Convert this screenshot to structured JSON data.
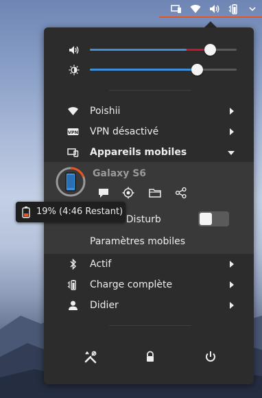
{
  "topbar": {
    "icons": [
      "phone-device-icon",
      "wifi-icon",
      "volume-icon",
      "battery-icon"
    ],
    "accent": "#e95420"
  },
  "sliders": {
    "volume": {
      "icon": "volume-icon",
      "level": 0.82
    },
    "brightness": {
      "icon": "brightness-icon",
      "level": 0.73
    }
  },
  "menu": {
    "wifi": {
      "label": "Poishii"
    },
    "vpn": {
      "label": "VPN désactivé"
    },
    "mobile": {
      "label": "Appareils mobiles"
    },
    "bluetooth": {
      "label": "Actif"
    },
    "battery": {
      "label": "Charge complète"
    },
    "user": {
      "label": "Didier"
    }
  },
  "device": {
    "name": "Galaxy S6",
    "battery_percent": 19,
    "dnd_label": "Do Not Disturb",
    "dnd_enabled": false,
    "settings_label": "Paramètres mobiles",
    "actions": [
      "message-icon",
      "locate-icon",
      "folder-icon",
      "share-icon"
    ]
  },
  "tooltip": {
    "text": "19% (4:46 Restant)"
  },
  "bottom_actions": [
    "settings-tools-icon",
    "lock-icon",
    "power-icon"
  ],
  "colors": {
    "popup_bg": "#2c2c2c",
    "submenu_bg": "#393939",
    "slider_fill": "#3f8fd9",
    "slider_over": "#c7162b",
    "ring_progress": "#e95420"
  }
}
